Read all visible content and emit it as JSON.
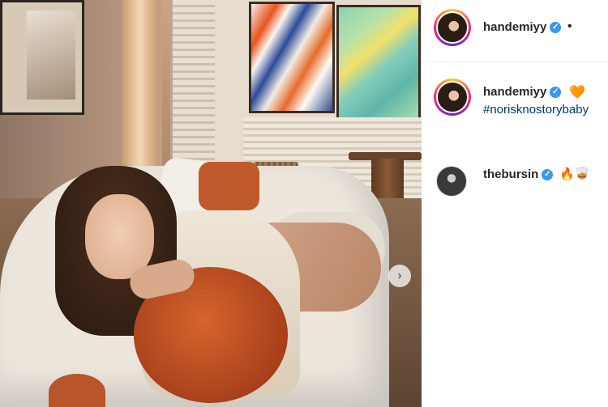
{
  "post": {
    "header": {
      "username": "handemiyy",
      "verified_label": "✓",
      "separator": "•"
    },
    "caption": {
      "username": "handemiyy",
      "verified_label": "✓",
      "heart": "🧡",
      "hashtag": "#norisknostorybaby"
    },
    "comments": [
      {
        "username": "thebursin",
        "verified_label": "✓",
        "emojis": "🔥🥃"
      }
    ],
    "next_button_glyph": "›"
  },
  "colors": {
    "verified": "#3897f0",
    "hashtag": "#00376b",
    "text": "#262626"
  }
}
